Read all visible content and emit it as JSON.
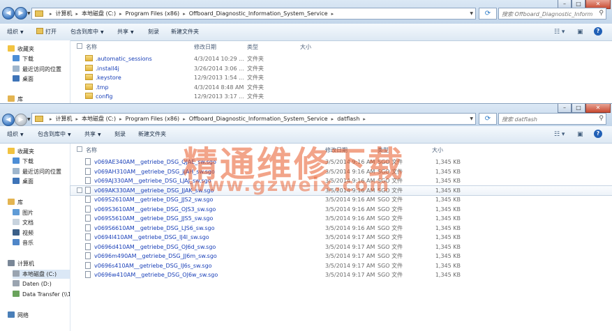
{
  "window1": {
    "breadcrumb": [
      "计算机",
      "本地磁盘 (C:)",
      "Program Files (x86)",
      "Offboard_Diagnostic_Information_System_Service"
    ],
    "search_placeholder": "搜索 Offboard_Diagnostic_Informa...",
    "commands": [
      "组织",
      "打开",
      "包含到库中",
      "共享",
      "刻录",
      "新建文件夹"
    ],
    "nav": [
      "收藏夹",
      "下载",
      "最近访问的位置",
      "桌面",
      "库"
    ],
    "columns": [
      "名称",
      "修改日期",
      "类型",
      "大小"
    ],
    "rows": [
      {
        "name": ".automatic_sessions",
        "date": "4/3/2014 10:29 ...",
        "type": "文件夹"
      },
      {
        "name": ".install4j",
        "date": "3/26/2014 3:06 ...",
        "type": "文件夹"
      },
      {
        "name": ".keystore",
        "date": "12/9/2013 1:54 ...",
        "type": "文件夹"
      },
      {
        "name": ".tmp",
        "date": "4/3/2014 8:48 AM",
        "type": "文件夹"
      },
      {
        "name": "config",
        "date": "12/9/2013 3:17 ...",
        "type": "文件夹"
      }
    ]
  },
  "window2": {
    "breadcrumb": [
      "计算机",
      "本地磁盘 (C:)",
      "Program Files (x86)",
      "Offboard_Diagnostic_Information_System_Service",
      "datflash"
    ],
    "search_placeholder": "搜索 datflash",
    "commands": [
      "组织",
      "包含到库中",
      "共享",
      "刻录",
      "新建文件夹"
    ],
    "nav": [
      "收藏夹",
      "下载",
      "最近访问的位置",
      "桌面",
      "库",
      "图片",
      "文档",
      "视频",
      "音乐",
      "计算机",
      "本地磁盘 (C:)",
      "Daten (D:)",
      "Data Transfer (\\\\1(",
      "网络"
    ],
    "columns": [
      "名称",
      "修改日期",
      "类型",
      "大小"
    ],
    "rows": [
      {
        "name": "v069AE340AM__getriebe_DSG_QJAE_sw.sgo",
        "date": "3/5/2014 9:16 AM",
        "type": "SGO 文件",
        "size": "1,345 KB"
      },
      {
        "name": "v069AH310AM__getriebe_DSG_JJAH_sw.sgo",
        "date": "3/5/2014 9:16 AM",
        "type": "SGO 文件",
        "size": "1,345 KB"
      },
      {
        "name": "v069AJ330AM__getriebe_DSG_LJAJ_sw.sgo",
        "date": "3/5/2014 9:16 AM",
        "type": "SGO 文件",
        "size": "1,345 KB"
      },
      {
        "name": "v069AK330AM__getriebe_DSG_JJAK_sw.sgo",
        "date": "3/5/2014 9:16 AM",
        "type": "SGO 文件",
        "size": "1,345 KB"
      },
      {
        "name": "v069S2610AM__getriebe_DSG_JJS2_sw.sgo",
        "date": "3/5/2014 9:16 AM",
        "type": "SGO 文件",
        "size": "1,345 KB"
      },
      {
        "name": "v069S3610AM__getriebe_DSG_OJS3_sw.sgo",
        "date": "3/5/2014 9:16 AM",
        "type": "SGO 文件",
        "size": "1,345 KB"
      },
      {
        "name": "v069S5610AM__getriebe_DSG_JJS5_sw.sgo",
        "date": "3/5/2014 9:16 AM",
        "type": "SGO 文件",
        "size": "1,345 KB"
      },
      {
        "name": "v069S6610AM__getriebe_DSG_LJS6_sw.sgo",
        "date": "3/5/2014 9:16 AM",
        "type": "SGO 文件",
        "size": "1,345 KB"
      },
      {
        "name": "v0694l410AM__getriebe_DSG_IJ4l_sw.sgo",
        "date": "3/5/2014 9:17 AM",
        "type": "SGO 文件",
        "size": "1,345 KB"
      },
      {
        "name": "v0696d410AM__getriebe_DSG_OJ6d_sw.sgo",
        "date": "3/5/2014 9:17 AM",
        "type": "SGO 文件",
        "size": "1,345 KB"
      },
      {
        "name": "v0696m490AM__getriebe_DSG_JJ6m_sw.sgo",
        "date": "3/5/2014 9:17 AM",
        "type": "SGO 文件",
        "size": "1,345 KB"
      },
      {
        "name": "v0696s410AM__getriebe_DSG_IJ6s_sw.sgo",
        "date": "3/5/2014 9:17 AM",
        "type": "SGO 文件",
        "size": "1,345 KB"
      },
      {
        "name": "v0696w410AM__getriebe_DSG_OJ6w_sw.sgo",
        "date": "3/5/2014 9:17 AM",
        "type": "SGO 文件",
        "size": "1,345 KB"
      }
    ]
  },
  "watermark": {
    "line1": "精通维修下载",
    "line2": "www.gzweix.com"
  }
}
